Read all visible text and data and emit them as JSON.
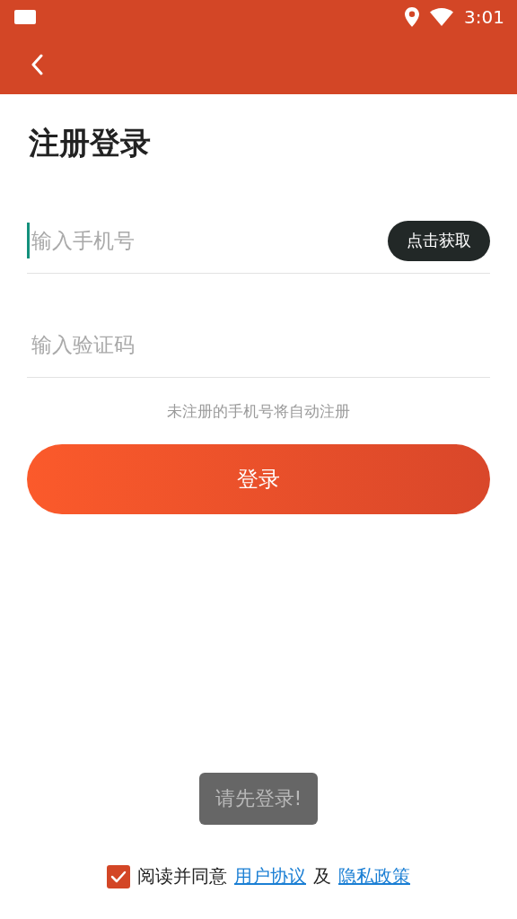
{
  "status_bar": {
    "time": "3:01"
  },
  "title": "注册登录",
  "phone_field": {
    "placeholder": "输入手机号",
    "focused": true
  },
  "code_button": "点击获取",
  "code_field": {
    "placeholder": "输入验证码",
    "focused": false
  },
  "hint": "未注册的手机号将自动注册",
  "login_button": "登录",
  "toast": "请先登录!",
  "agreement": {
    "checked": true,
    "text": "阅读并同意",
    "link_1": "用户协议",
    "joiner": "及",
    "link_2": "隐私政策"
  }
}
